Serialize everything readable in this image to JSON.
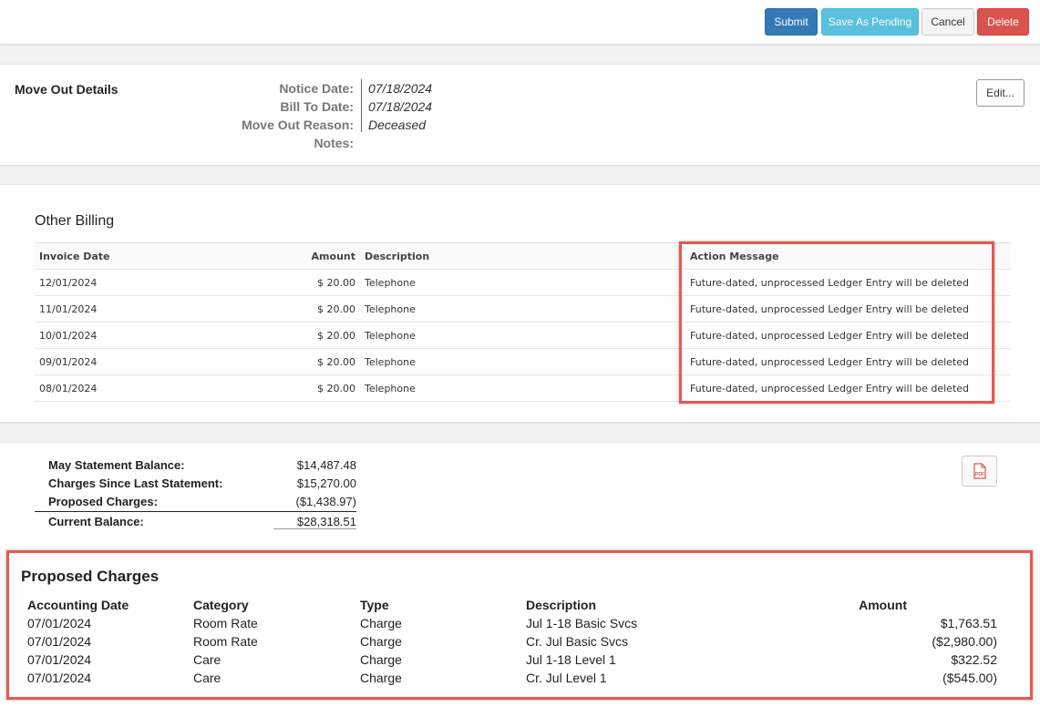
{
  "actions": {
    "submit": "Submit",
    "save_pending": "Save As Pending",
    "cancel": "Cancel",
    "delete": "Delete"
  },
  "move_out": {
    "title": "Move Out Details",
    "fields": [
      {
        "label": "Notice Date:",
        "value": "07/18/2024"
      },
      {
        "label": "Bill To Date:",
        "value": "07/18/2024"
      },
      {
        "label": "Move Out Reason:",
        "value": "Deceased"
      },
      {
        "label": "Notes:",
        "value": ""
      }
    ],
    "edit_label": "Edit..."
  },
  "other_billing": {
    "title": "Other Billing",
    "columns": [
      "Invoice Date",
      "Amount",
      "Description",
      "Action Message"
    ],
    "rows": [
      {
        "date": "12/01/2024",
        "amount": "$ 20.00",
        "description": "Telephone",
        "message": "Future-dated, unprocessed Ledger Entry will be deleted"
      },
      {
        "date": "11/01/2024",
        "amount": "$ 20.00",
        "description": "Telephone",
        "message": "Future-dated, unprocessed Ledger Entry will be deleted"
      },
      {
        "date": "10/01/2024",
        "amount": "$ 20.00",
        "description": "Telephone",
        "message": "Future-dated, unprocessed Ledger Entry will be deleted"
      },
      {
        "date": "09/01/2024",
        "amount": "$ 20.00",
        "description": "Telephone",
        "message": "Future-dated, unprocessed Ledger Entry will be deleted"
      },
      {
        "date": "08/01/2024",
        "amount": "$ 20.00",
        "description": "Telephone",
        "message": "Future-dated, unprocessed Ledger Entry will be deleted"
      }
    ]
  },
  "balance": {
    "rows": [
      {
        "label": "May Statement Balance:",
        "value": "$14,487.48"
      },
      {
        "label": "Charges Since Last Statement:",
        "value": "$15,270.00"
      },
      {
        "label": "Proposed Charges:",
        "value": "($1,438.97)"
      },
      {
        "label": "Current Balance:",
        "value": "$28,318.51"
      }
    ],
    "pdf_icon": "pdf-file-icon",
    "pdf_text": "PDF"
  },
  "proposed_charges": {
    "title": "Proposed Charges",
    "columns": [
      "Accounting Date",
      "Category",
      "Type",
      "Description",
      "Amount"
    ],
    "rows": [
      {
        "date": "07/01/2024",
        "category": "Room Rate",
        "type": "Charge",
        "description": "Jul 1-18 Basic Svcs",
        "amount": "$1,763.51"
      },
      {
        "date": "07/01/2024",
        "category": "Room Rate",
        "type": "Charge",
        "description": "Cr. Jul Basic Svcs",
        "amount": "($2,980.00)"
      },
      {
        "date": "07/01/2024",
        "category": "Care",
        "type": "Charge",
        "description": "Jul 1-18 Level 1",
        "amount": "$322.52"
      },
      {
        "date": "07/01/2024",
        "category": "Care",
        "type": "Charge",
        "description": "Cr. Jul Level 1",
        "amount": "($545.00)"
      }
    ]
  },
  "colors": {
    "highlight": "#e8584f",
    "primary": "#337ab7",
    "info": "#5bc0de",
    "danger": "#d9534f"
  }
}
